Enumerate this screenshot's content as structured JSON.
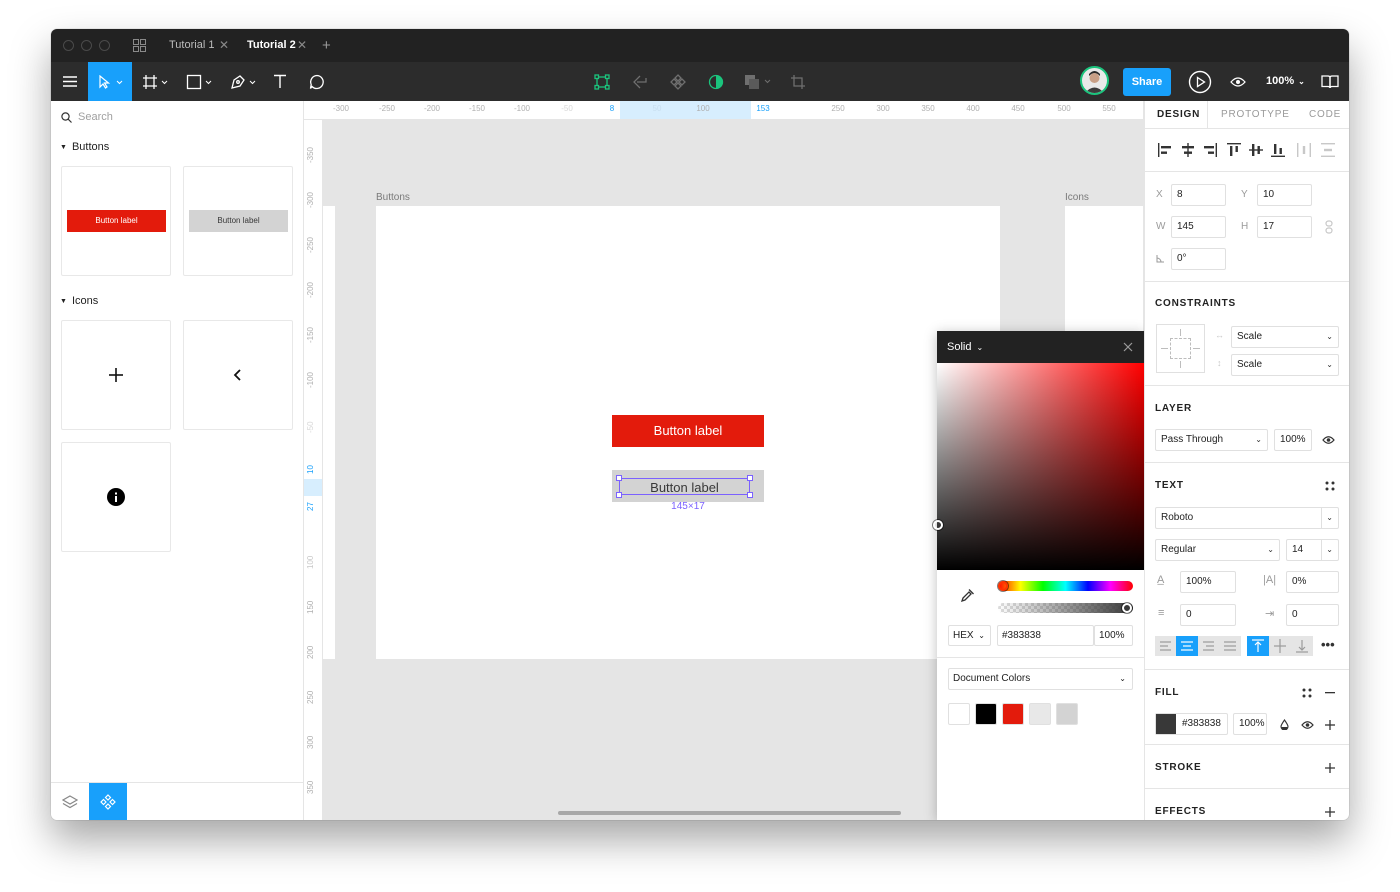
{
  "titlebar": {
    "tabs": [
      {
        "label": "Tutorial 1"
      },
      {
        "label": "Tutorial 2"
      }
    ],
    "tab_close": "✕",
    "new_tab": "+"
  },
  "toolbar": {
    "share_label": "Share",
    "zoom_label": "100%"
  },
  "left_panel": {
    "search_placeholder": "Search",
    "sections": [
      {
        "label": "Buttons"
      },
      {
        "label": "Icons"
      }
    ],
    "buttons": {
      "primary_label": "Button label",
      "secondary_label": "Button label"
    }
  },
  "rulers": {
    "horizontal": [
      "-300",
      "-250",
      "-200",
      "-150",
      "-100",
      "-50",
      "8",
      "50",
      "100",
      "153",
      "250",
      "300",
      "350",
      "400",
      "450",
      "500",
      "550"
    ],
    "vertical": [
      "-350",
      "-300",
      "-250",
      "-200",
      "-150",
      "-100",
      "-50",
      "10",
      "27",
      "100",
      "150",
      "200",
      "250",
      "300",
      "350"
    ]
  },
  "canvas": {
    "frame_buttons_label": "Buttons",
    "frame_icons_label": "Icons",
    "primary_button": "Button label",
    "secondary_button": "Button label",
    "selection_size": "145×17"
  },
  "color_picker": {
    "mode": "Solid",
    "format": "HEX",
    "hex": "#383838",
    "opacity": "100%",
    "library": "Document Colors",
    "swatches": [
      "#ffffff",
      "#000000",
      "#e31b0c",
      "#e8e8e8",
      "#d3d3d3"
    ]
  },
  "right_panel": {
    "tabs": [
      {
        "label": "DESIGN"
      },
      {
        "label": "PROTOTYPE"
      },
      {
        "label": "CODE"
      }
    ],
    "geometry": {
      "x_label": "X",
      "x": "8",
      "y_label": "Y",
      "y": "10",
      "w_label": "W",
      "w": "145",
      "h_label": "H",
      "h": "17",
      "rotation": "0°"
    },
    "constraints": {
      "title": "CONSTRAINTS",
      "horizontal": "Scale",
      "vertical": "Scale"
    },
    "layer": {
      "title": "LAYER",
      "blend": "Pass Through",
      "opacity": "100%"
    },
    "text": {
      "title": "TEXT",
      "font": "Roboto",
      "weight": "Regular",
      "size": "14",
      "line_height": "100%",
      "letter_spacing": "0%",
      "paragraph_spacing": "0",
      "indent": "0"
    },
    "fill": {
      "title": "FILL",
      "hex": "#383838",
      "opacity": "100%"
    },
    "stroke": {
      "title": "STROKE"
    },
    "effects": {
      "title": "EFFECTS"
    }
  },
  "colors": {
    "accent": "#18a0fb",
    "selection": "#7b61ff",
    "primary_button": "#e31b0c",
    "secondary_button": "#d3d3d3",
    "fill": "#383838"
  }
}
